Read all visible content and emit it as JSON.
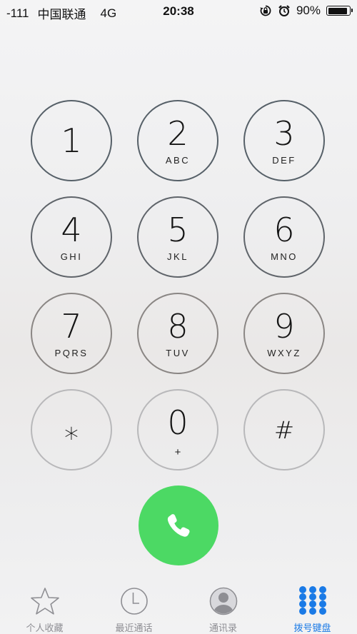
{
  "status_bar": {
    "signal": "-111",
    "carrier": "中国联通",
    "network": "4G",
    "time": "20:38",
    "battery_percent": "90%",
    "battery_level": 0.9,
    "icons": [
      "rotation-lock-icon",
      "alarm-icon",
      "battery-icon"
    ]
  },
  "keypad": {
    "keys": [
      {
        "digit": "1",
        "letters": ""
      },
      {
        "digit": "2",
        "letters": "ABC"
      },
      {
        "digit": "3",
        "letters": "DEF"
      },
      {
        "digit": "4",
        "letters": "GHI"
      },
      {
        "digit": "5",
        "letters": "JKL"
      },
      {
        "digit": "6",
        "letters": "MNO"
      },
      {
        "digit": "7",
        "letters": "PQRS"
      },
      {
        "digit": "8",
        "letters": "TUV"
      },
      {
        "digit": "9",
        "letters": "WXYZ"
      },
      {
        "digit": "⁎",
        "letters": ""
      },
      {
        "digit": "0",
        "letters": "+"
      },
      {
        "digit": "#",
        "letters": ""
      }
    ]
  },
  "call_button": {
    "icon": "phone-icon",
    "color": "#4cd964"
  },
  "tab_bar": {
    "active_color": "#1a7ae6",
    "inactive_color": "#8e8e93",
    "tabs": [
      {
        "label": "个人收藏",
        "icon": "star-icon",
        "active": false
      },
      {
        "label": "最近通话",
        "icon": "clock-icon",
        "active": false
      },
      {
        "label": "通讯录",
        "icon": "contact-icon",
        "active": false
      },
      {
        "label": "拨号键盘",
        "icon": "keypad-icon",
        "active": true
      }
    ]
  }
}
